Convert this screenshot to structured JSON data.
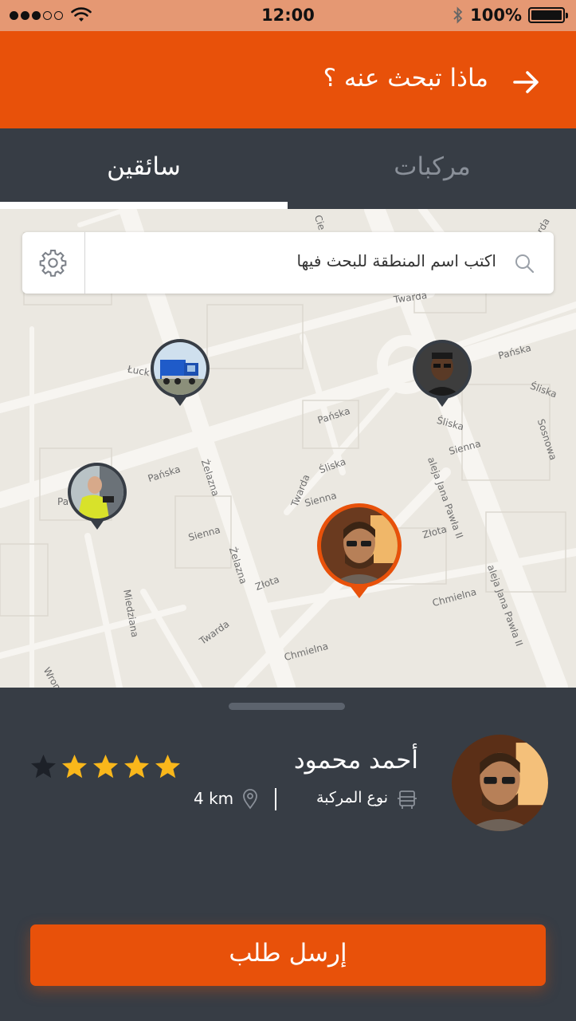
{
  "status_bar": {
    "time": "12:00",
    "battery": "100%",
    "signal_bars_filled": 3,
    "signal_bars_total": 5
  },
  "header": {
    "title": "ماذا تبحث عنه ؟",
    "back_icon": "arrow-right-icon"
  },
  "tabs": [
    {
      "label": "سائقين",
      "active": true
    },
    {
      "label": "مركبات",
      "active": false
    }
  ],
  "search": {
    "placeholder": "اكتب اسم المنطقة للبحث فيها",
    "settings_icon": "gear-icon",
    "search_icon": "search-icon"
  },
  "map": {
    "street_labels": [
      "Twarda",
      "Pańska",
      "Śliska",
      "Sienna",
      "Złota",
      "Chmielna",
      "Żelazna",
      "Miedziana",
      "aleja Jana Pawła II",
      "Łuck",
      "Sosnowa",
      "Wron",
      "Cie",
      "rda",
      "Pa"
    ]
  },
  "driver_card": {
    "name": "أحمد محمود",
    "vehicle_type": "نوع المركبة",
    "distance": "4 km",
    "rating": 4,
    "rating_max": 5
  },
  "actions": {
    "send_request": "إرسل طلب"
  },
  "colors": {
    "accent": "#e8510a",
    "dark": "#373d45",
    "star": "#f9b71b",
    "map_bg": "#ebe8e1"
  }
}
